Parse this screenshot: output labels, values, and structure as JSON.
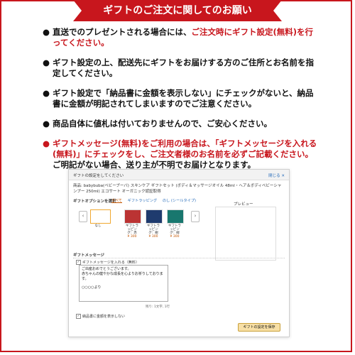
{
  "banner": "ギフトのご注文に関してのお願い",
  "notes": [
    {
      "bullet": "●",
      "parts": [
        {
          "text": "直送でのプレゼントされる場合には、",
          "red": false
        },
        {
          "text": "ご注文時にギフト設定(無料)を行ってください。",
          "red": true
        }
      ]
    },
    {
      "bullet": "●",
      "parts": [
        {
          "text": "ギフト設定の上、配送先にギフトをお届けする方のご住所とお名前を指定してください。",
          "red": false
        }
      ]
    },
    {
      "bullet": "●",
      "parts": [
        {
          "text": "ギフト設定で「納品書に金額を表示しない」にチェックがないと、納品書に金額が明記されてしまいますのでご注意ください。",
          "red": false
        }
      ]
    },
    {
      "bullet": "●",
      "parts": [
        {
          "text": "商品自体に値札は付いておりませんので、ご安心ください。",
          "red": false
        }
      ]
    },
    {
      "bullet": "●",
      "parts": [
        {
          "text": "ギフトメッセージ(無料)をご利用の場合は、「ギフトメッセージを入れる(無料)」にチェックをし、ご注文者様のお名前を必ずご記載ください。",
          "red": true
        },
        {
          "text": "ご明記がない場合、送り主が不明でお届けとなります。",
          "red": false
        }
      ]
    }
  ],
  "dialog": {
    "title": "ギフトの設定をしてください",
    "close": "閉じる ✕",
    "product": "商品: babybuba(ベビーブーバ) スキンケア ギフトセット (ボディ＆マッサージオイル 48ml・ヘア＆ボディベビーシャンプー 250ml) エコサート オーガニック認証取得",
    "gift_options_label": "ギフトオプションを選択",
    "tabs": [
      "すべて",
      "ギフトラッピング",
      "のし (シールタイプ)"
    ],
    "prev": "‹",
    "next": "›",
    "wraps": [
      {
        "name": "なし",
        "price": ""
      },
      {
        "name": "ギフトラッピング：赤",
        "price": "¥ 300"
      },
      {
        "name": "ギフトラッピング：紺",
        "price": "¥ 300"
      },
      {
        "name": "ギフトラッピング：緑",
        "price": "¥ 300"
      }
    ],
    "preview_label": "プレビュー",
    "message_section": "ギフトメッセージ",
    "message_checkbox": "ギフトメッセージを入れる（無料）",
    "message_lines": [
      "ご出産おめでとうございます。",
      "赤ちゃんの健やかな成長を心よりお祈りしております。"
    ],
    "message_sign": "○○○○より",
    "counter": "残り: 1文字, 1行",
    "invoice_checkbox": "納品書に金額を表示しない",
    "save_button": "ギフトの設定を保存"
  }
}
